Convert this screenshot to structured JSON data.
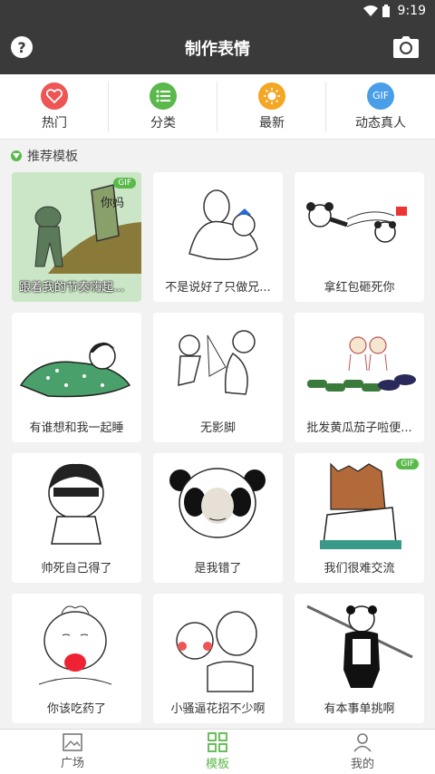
{
  "status": {
    "time": "9:19"
  },
  "header": {
    "title": "制作表情",
    "help_icon": "?"
  },
  "categories": [
    {
      "label": "热门",
      "icon": "heart-icon",
      "color": "#ee5555"
    },
    {
      "label": "分类",
      "icon": "list-icon",
      "color": "#5ab94a"
    },
    {
      "label": "最新",
      "icon": "sun-icon",
      "color": "#f5a623"
    },
    {
      "label": "动态真人",
      "icon": "gif-icon",
      "color": "#4a9ee8",
      "badge": "GIF"
    }
  ],
  "section": {
    "title": "推荐模板"
  },
  "templates": [
    {
      "caption": "跟着我的节奏嗨起...",
      "gif": "GIF",
      "art_text": "你妈"
    },
    {
      "caption": "不是说好了只做兄..."
    },
    {
      "caption": "拿红包砸死你"
    },
    {
      "caption": "有谁想和我一起睡"
    },
    {
      "caption": "无影脚"
    },
    {
      "caption": "批发黄瓜茄子啦便..."
    },
    {
      "caption": "帅死自己得了"
    },
    {
      "caption": "是我错了"
    },
    {
      "caption": "我们很难交流",
      "gif": "GIF"
    },
    {
      "caption": "你该吃药了"
    },
    {
      "caption": "小骚逼花招不少啊"
    },
    {
      "caption": "有本事单挑啊"
    }
  ],
  "tabs": [
    {
      "label": "广场",
      "icon": "image-icon"
    },
    {
      "label": "模板",
      "icon": "grid-icon",
      "active": true
    },
    {
      "label": "我的",
      "icon": "user-icon"
    }
  ]
}
